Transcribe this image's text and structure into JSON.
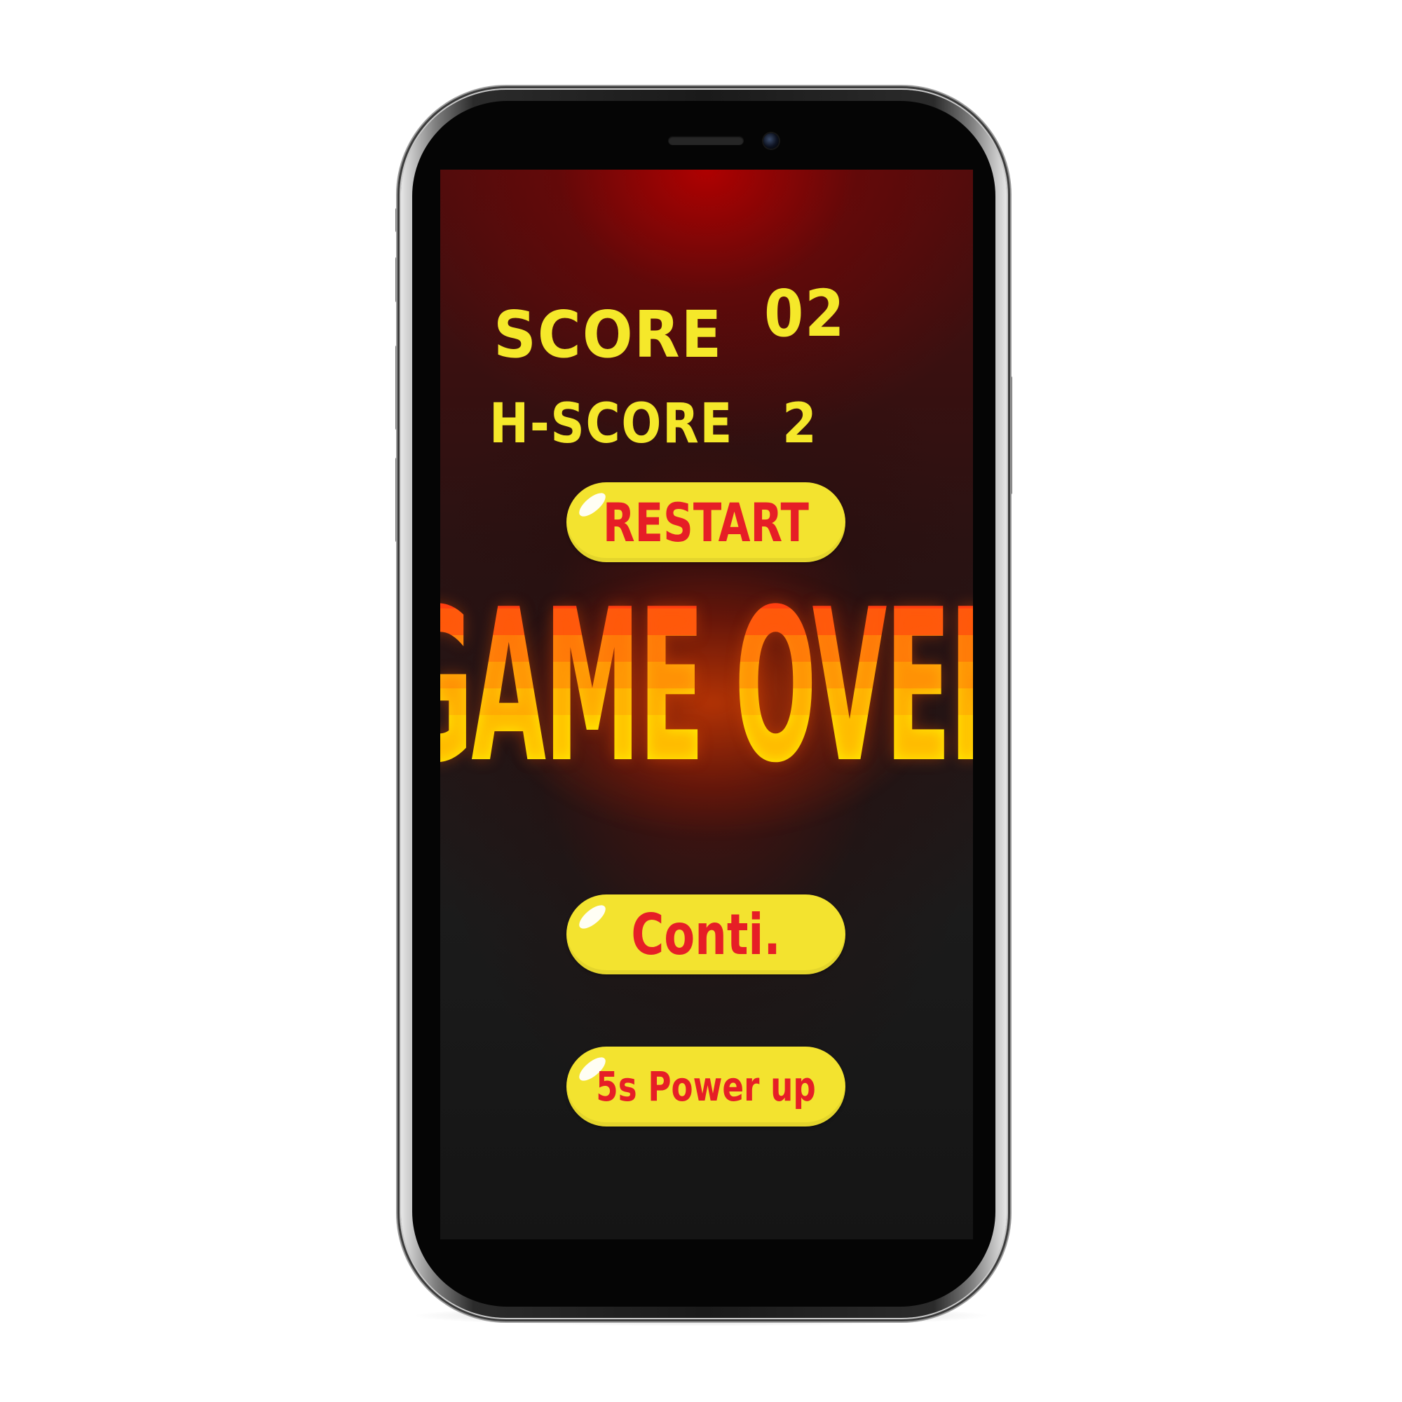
{
  "game": {
    "score_label": "SCORE",
    "score_value": "02",
    "hscore_label": "H-SCORE",
    "hscore_value": "2",
    "title": "GAME OVER"
  },
  "buttons": {
    "restart": "RESTART",
    "continue": "Conti.",
    "power_up": "5s Power up"
  },
  "colors": {
    "score_text": "#f5e82a",
    "button_fill": "#f3e32f",
    "button_text": "#e61e26",
    "game_over_top": "#ff3a14",
    "game_over_bottom": "#fff000"
  }
}
